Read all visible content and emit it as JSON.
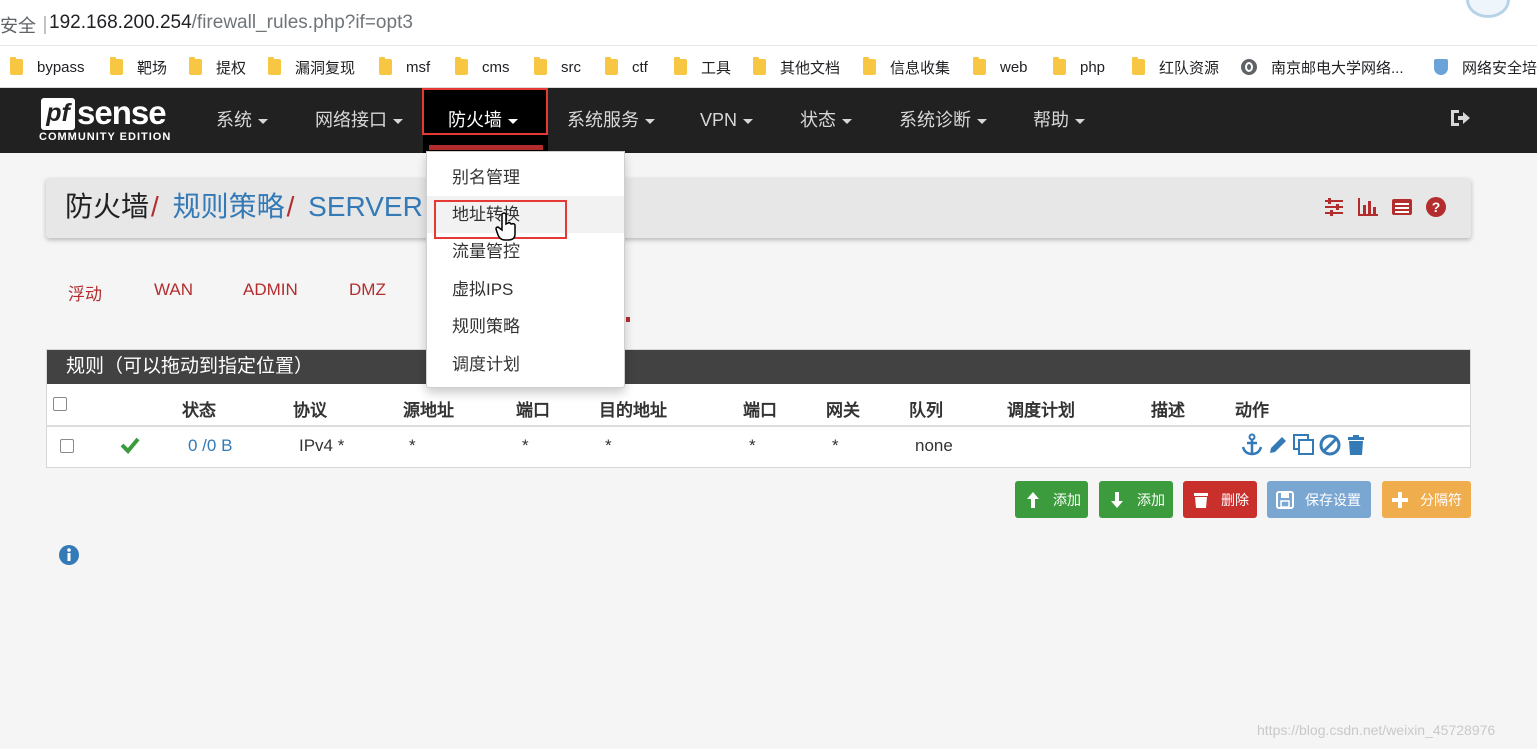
{
  "browser": {
    "security_label": "安全｜",
    "url_host": "192.168.200.254",
    "url_path": "/firewall_rules.php?if=opt3",
    "bookmarks": [
      {
        "label": "bypass",
        "icon": "folder-icon"
      },
      {
        "label": "靶场",
        "icon": "folder-icon"
      },
      {
        "label": "提权",
        "icon": "folder-icon"
      },
      {
        "label": "漏洞复现",
        "icon": "folder-icon"
      },
      {
        "label": "msf",
        "icon": "folder-icon"
      },
      {
        "label": "cms",
        "icon": "folder-icon"
      },
      {
        "label": "src",
        "icon": "folder-icon"
      },
      {
        "label": "ctf",
        "icon": "folder-icon"
      },
      {
        "label": "工具",
        "icon": "folder-icon"
      },
      {
        "label": "其他文档",
        "icon": "folder-icon"
      },
      {
        "label": "信息收集",
        "icon": "folder-icon"
      },
      {
        "label": "web",
        "icon": "folder-icon"
      },
      {
        "label": "php",
        "icon": "folder-icon"
      },
      {
        "label": "红队资源",
        "icon": "folder-icon"
      },
      {
        "label": "南京邮电大学网络...",
        "icon": "globe-icon"
      },
      {
        "label": "网络安全培",
        "icon": "shield-icon"
      }
    ]
  },
  "logo": {
    "pf": "pf",
    "sense": "sense",
    "edition": "COMMUNITY EDITION"
  },
  "nav": {
    "items": [
      "系统",
      "网络接口",
      "防火墙",
      "系统服务",
      "VPN",
      "状态",
      "系统诊断",
      "帮助"
    ],
    "active": "防火墙"
  },
  "dropdown": {
    "items": [
      "别名管理",
      "地址转换",
      "流量管控",
      "虚拟IPS",
      "规则策略",
      "调度计划"
    ],
    "hovered": "地址转换"
  },
  "breadcrumb": {
    "part1": "防火墙",
    "sep": "/",
    "part2": "规则策略",
    "part3": "SERVER"
  },
  "tabs": [
    "浮动",
    "WAN",
    "ADMIN",
    "DMZ"
  ],
  "panel": {
    "title": "规则（可以拖动到指定位置）",
    "headers": [
      "状态",
      "协议",
      "源地址",
      "端口",
      "目的地址",
      "端口",
      "网关",
      "队列",
      "调度计划",
      "描述",
      "动作"
    ],
    "rows": [
      {
        "states": "0 /0 B",
        "protocol": "IPv4 *",
        "source": "*",
        "sport": "*",
        "dest": "*",
        "dport": "*",
        "gateway": "*",
        "queue": "none",
        "schedule": "",
        "description": ""
      }
    ]
  },
  "buttons": [
    {
      "label": "添加",
      "color": "#3c9b3c",
      "icon": "arrow-up-icon"
    },
    {
      "label": "添加",
      "color": "#3c9b3c",
      "icon": "arrow-down-icon"
    },
    {
      "label": "删除",
      "color": "#c9302c",
      "icon": "trash-icon"
    },
    {
      "label": "保存设置",
      "color": "#7aa6d2",
      "icon": "save-icon"
    },
    {
      "label": "分隔符",
      "color": "#f0ad4e",
      "icon": "plus-icon"
    }
  ],
  "colors": {
    "accent_red": "#b32d2e",
    "link_blue": "#337ab7",
    "navbar": "#212121",
    "check_green": "#3c9b3c"
  },
  "watermark": "https://blog.csdn.net/weixin_45728976"
}
